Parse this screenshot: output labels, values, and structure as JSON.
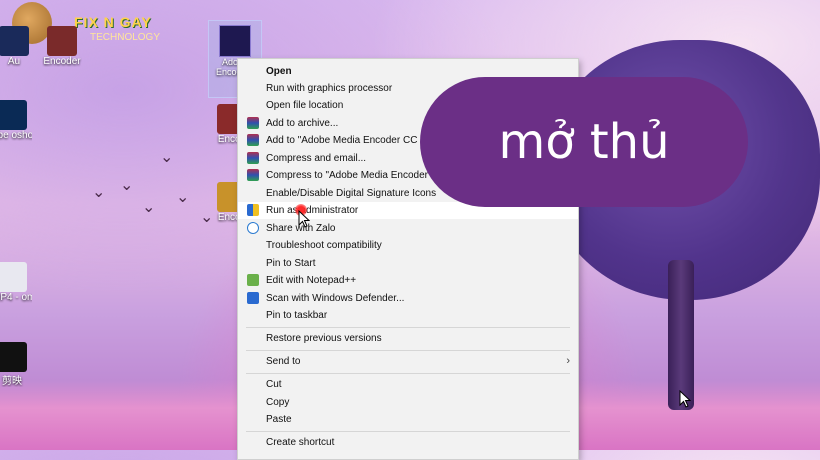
{
  "watermark": {
    "brand": "FIX N GAY",
    "sub": "TECHNOLOGY"
  },
  "desktop_icons": [
    {
      "label": "Au",
      "color": "#1a2a5a"
    },
    {
      "label": "Encoder",
      "color": "#7a2a2a"
    },
    {
      "label": "Adobe Encod 20",
      "color": "#1e1850"
    },
    {
      "label": "Encod",
      "color": "#8a2a2a"
    },
    {
      "label": "Encod",
      "color": "#c8922a"
    },
    {
      "label": "Ps",
      "color": "#0a2a55"
    },
    {
      "label": "obe oshop",
      "color": "#0a2a55"
    },
    {
      "label": "MP3",
      "color": "#e8e8f0"
    },
    {
      "label": "MP4 - om",
      "color": "#e8e8f0"
    },
    {
      "label": "CapCut",
      "color": "#111111"
    },
    {
      "label": "剪映",
      "color": "#111111"
    }
  ],
  "context_menu": {
    "items": [
      {
        "label": "Open",
        "bold": true
      },
      {
        "label": "Run with graphics processor"
      },
      {
        "label": "Open file location"
      },
      {
        "label": "Add to archive...",
        "icon": "winrar-icon"
      },
      {
        "label": "Add to \"Adobe Media Encoder CC 20",
        "icon": "winrar-icon"
      },
      {
        "label": "Compress and email...",
        "icon": "winrar-icon"
      },
      {
        "label": "Compress to \"Adobe Media Encoder CC",
        "icon": "winrar-icon"
      },
      {
        "label": "Enable/Disable Digital Signature Icons"
      },
      {
        "label": "Run as administrator",
        "icon": "uac-shield-icon"
      },
      {
        "label": "Share with Zalo",
        "icon": "zalo-icon"
      },
      {
        "label": "Troubleshoot compatibility"
      },
      {
        "label": "Pin to Start"
      },
      {
        "label": "Edit with Notepad++",
        "icon": "notepadpp-icon"
      },
      {
        "label": "Scan with Windows Defender...",
        "icon": "defender-icon"
      },
      {
        "label": "Pin to taskbar"
      },
      {
        "label": "Restore previous versions"
      },
      {
        "label": "Send to",
        "submenu": true
      },
      {
        "label": "Cut"
      },
      {
        "label": "Copy"
      },
      {
        "label": "Paste"
      },
      {
        "label": "Create shortcut"
      }
    ]
  },
  "overlay_caption": "mở thủ",
  "colors": {
    "caption_bg": "#6b2f86",
    "menu_bg": "#f2f2f2",
    "tree": "#4a2d87"
  }
}
